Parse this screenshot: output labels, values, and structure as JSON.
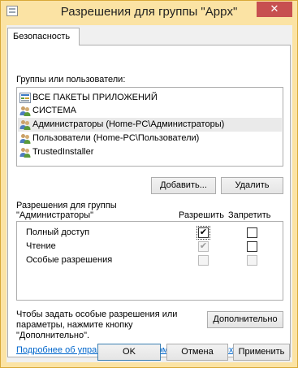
{
  "window": {
    "title": "Разрешения для группы \"Appx\"",
    "close_label": "✕"
  },
  "tabs": [
    {
      "label": "Безопасность",
      "selected": true
    }
  ],
  "groups": {
    "label": "Группы или пользователи:",
    "items": [
      {
        "label": "ВСЕ ПАКЕТЫ ПРИЛОЖЕНИЙ",
        "icon": "app-packages-icon",
        "selected": false
      },
      {
        "label": "СИСТЕМА",
        "icon": "users-group-icon",
        "selected": false
      },
      {
        "label": "Администраторы (Home-PC\\Администраторы)",
        "icon": "users-group-icon",
        "selected": true
      },
      {
        "label": "Пользователи (Home-PC\\Пользователи)",
        "icon": "users-group-icon",
        "selected": false
      },
      {
        "label": "TrustedInstaller",
        "icon": "users-group-icon",
        "selected": false
      }
    ]
  },
  "buttons": {
    "add": "Добавить...",
    "remove": "Удалить",
    "advanced": "Дополнительно",
    "ok": "OK",
    "cancel": "Отмена",
    "apply": "Применить"
  },
  "permissions": {
    "header_line1": "Разрешения для группы",
    "header_line2": "\"Администраторы\"",
    "col_allow": "Разрешить",
    "col_deny": "Запретить",
    "rows": [
      {
        "name": "Полный доступ",
        "allow": true,
        "allow_disabled": false,
        "deny": false
      },
      {
        "name": "Чтение",
        "allow": true,
        "allow_disabled": true,
        "deny": false
      },
      {
        "name": "Особые разрешения",
        "allow": false,
        "allow_disabled": true,
        "deny": false
      }
    ]
  },
  "special": {
    "line1": "Чтобы задать особые разрешения или",
    "line2": "параметры, нажмите кнопку",
    "line3": "\"Дополнительно\"."
  },
  "help_link": "Подробнее об управлении доступом и разрешениях"
}
